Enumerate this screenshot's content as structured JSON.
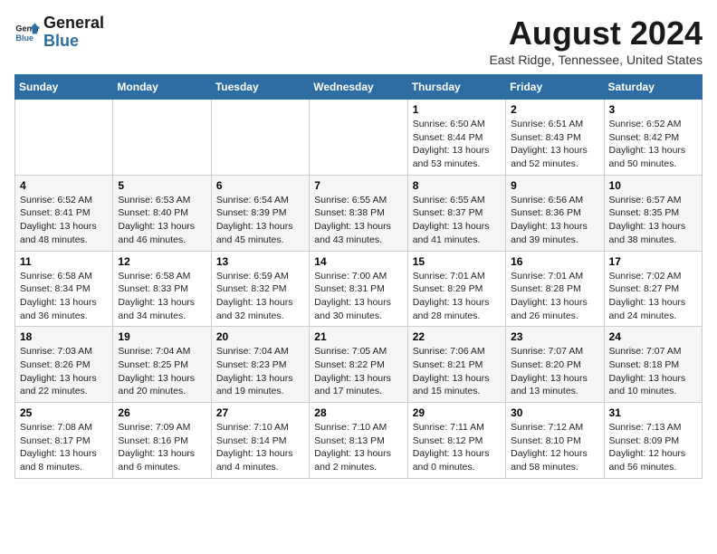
{
  "header": {
    "logo_line1": "General",
    "logo_line2": "Blue",
    "month_year": "August 2024",
    "location": "East Ridge, Tennessee, United States"
  },
  "weekdays": [
    "Sunday",
    "Monday",
    "Tuesday",
    "Wednesday",
    "Thursday",
    "Friday",
    "Saturday"
  ],
  "weeks": [
    [
      {
        "day": "",
        "info": ""
      },
      {
        "day": "",
        "info": ""
      },
      {
        "day": "",
        "info": ""
      },
      {
        "day": "",
        "info": ""
      },
      {
        "day": "1",
        "info": "Sunrise: 6:50 AM\nSunset: 8:44 PM\nDaylight: 13 hours and 53 minutes."
      },
      {
        "day": "2",
        "info": "Sunrise: 6:51 AM\nSunset: 8:43 PM\nDaylight: 13 hours and 52 minutes."
      },
      {
        "day": "3",
        "info": "Sunrise: 6:52 AM\nSunset: 8:42 PM\nDaylight: 13 hours and 50 minutes."
      }
    ],
    [
      {
        "day": "4",
        "info": "Sunrise: 6:52 AM\nSunset: 8:41 PM\nDaylight: 13 hours and 48 minutes."
      },
      {
        "day": "5",
        "info": "Sunrise: 6:53 AM\nSunset: 8:40 PM\nDaylight: 13 hours and 46 minutes."
      },
      {
        "day": "6",
        "info": "Sunrise: 6:54 AM\nSunset: 8:39 PM\nDaylight: 13 hours and 45 minutes."
      },
      {
        "day": "7",
        "info": "Sunrise: 6:55 AM\nSunset: 8:38 PM\nDaylight: 13 hours and 43 minutes."
      },
      {
        "day": "8",
        "info": "Sunrise: 6:55 AM\nSunset: 8:37 PM\nDaylight: 13 hours and 41 minutes."
      },
      {
        "day": "9",
        "info": "Sunrise: 6:56 AM\nSunset: 8:36 PM\nDaylight: 13 hours and 39 minutes."
      },
      {
        "day": "10",
        "info": "Sunrise: 6:57 AM\nSunset: 8:35 PM\nDaylight: 13 hours and 38 minutes."
      }
    ],
    [
      {
        "day": "11",
        "info": "Sunrise: 6:58 AM\nSunset: 8:34 PM\nDaylight: 13 hours and 36 minutes."
      },
      {
        "day": "12",
        "info": "Sunrise: 6:58 AM\nSunset: 8:33 PM\nDaylight: 13 hours and 34 minutes."
      },
      {
        "day": "13",
        "info": "Sunrise: 6:59 AM\nSunset: 8:32 PM\nDaylight: 13 hours and 32 minutes."
      },
      {
        "day": "14",
        "info": "Sunrise: 7:00 AM\nSunset: 8:31 PM\nDaylight: 13 hours and 30 minutes."
      },
      {
        "day": "15",
        "info": "Sunrise: 7:01 AM\nSunset: 8:29 PM\nDaylight: 13 hours and 28 minutes."
      },
      {
        "day": "16",
        "info": "Sunrise: 7:01 AM\nSunset: 8:28 PM\nDaylight: 13 hours and 26 minutes."
      },
      {
        "day": "17",
        "info": "Sunrise: 7:02 AM\nSunset: 8:27 PM\nDaylight: 13 hours and 24 minutes."
      }
    ],
    [
      {
        "day": "18",
        "info": "Sunrise: 7:03 AM\nSunset: 8:26 PM\nDaylight: 13 hours and 22 minutes."
      },
      {
        "day": "19",
        "info": "Sunrise: 7:04 AM\nSunset: 8:25 PM\nDaylight: 13 hours and 20 minutes."
      },
      {
        "day": "20",
        "info": "Sunrise: 7:04 AM\nSunset: 8:23 PM\nDaylight: 13 hours and 19 minutes."
      },
      {
        "day": "21",
        "info": "Sunrise: 7:05 AM\nSunset: 8:22 PM\nDaylight: 13 hours and 17 minutes."
      },
      {
        "day": "22",
        "info": "Sunrise: 7:06 AM\nSunset: 8:21 PM\nDaylight: 13 hours and 15 minutes."
      },
      {
        "day": "23",
        "info": "Sunrise: 7:07 AM\nSunset: 8:20 PM\nDaylight: 13 hours and 13 minutes."
      },
      {
        "day": "24",
        "info": "Sunrise: 7:07 AM\nSunset: 8:18 PM\nDaylight: 13 hours and 10 minutes."
      }
    ],
    [
      {
        "day": "25",
        "info": "Sunrise: 7:08 AM\nSunset: 8:17 PM\nDaylight: 13 hours and 8 minutes."
      },
      {
        "day": "26",
        "info": "Sunrise: 7:09 AM\nSunset: 8:16 PM\nDaylight: 13 hours and 6 minutes."
      },
      {
        "day": "27",
        "info": "Sunrise: 7:10 AM\nSunset: 8:14 PM\nDaylight: 13 hours and 4 minutes."
      },
      {
        "day": "28",
        "info": "Sunrise: 7:10 AM\nSunset: 8:13 PM\nDaylight: 13 hours and 2 minutes."
      },
      {
        "day": "29",
        "info": "Sunrise: 7:11 AM\nSunset: 8:12 PM\nDaylight: 13 hours and 0 minutes."
      },
      {
        "day": "30",
        "info": "Sunrise: 7:12 AM\nSunset: 8:10 PM\nDaylight: 12 hours and 58 minutes."
      },
      {
        "day": "31",
        "info": "Sunrise: 7:13 AM\nSunset: 8:09 PM\nDaylight: 12 hours and 56 minutes."
      }
    ]
  ]
}
